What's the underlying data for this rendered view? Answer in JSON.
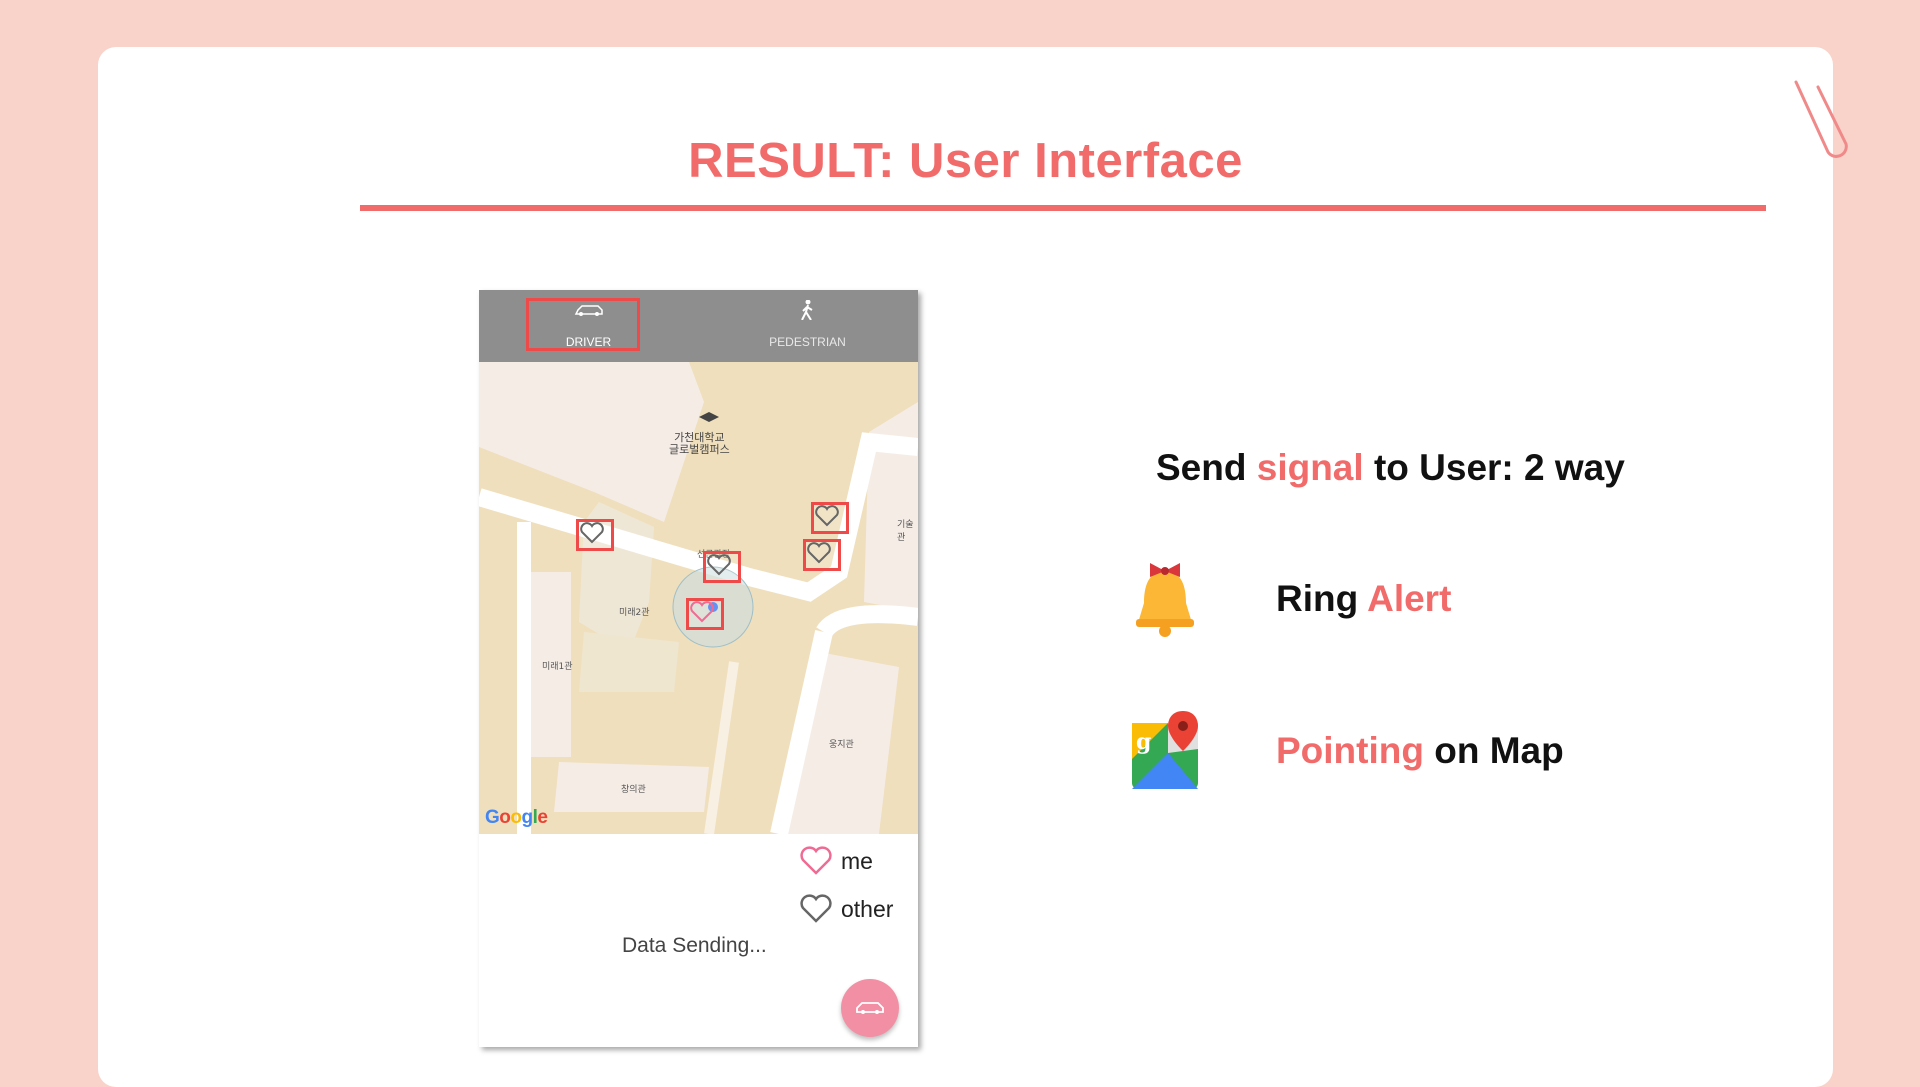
{
  "slide": {
    "title": "RESULT: User Interface"
  },
  "phone": {
    "tabs": [
      {
        "label": "DRIVER",
        "icon": "car-icon",
        "selected": true
      },
      {
        "label": "PEDESTRIAN",
        "icon": "pedestrian-icon",
        "selected": false
      }
    ],
    "map": {
      "provider_logo": "Google",
      "labels": {
        "campus": "가천대학교\n글로벌캠퍼스",
        "mirae2": "미래2관",
        "mirae1": "미래1관",
        "unggi": "웅지관",
        "changui": "창의관",
        "gisul": "기술관",
        "seonbae": "선큰광장"
      }
    },
    "legend": {
      "me": "me",
      "other": "other"
    },
    "status": "Data Sending...",
    "colors": {
      "tabbar": "#8e8e8e",
      "highlight": "#ef4a4a",
      "me_heart": "#f06b93",
      "other_heart": "#666666",
      "fab": "#f28fa4"
    }
  },
  "right": {
    "heading": {
      "part1": "Send ",
      "accent": "signal",
      "part2": " to User: 2 way"
    },
    "features": [
      {
        "icon": "bell-icon",
        "text": "Ring ",
        "accent": "Alert"
      },
      {
        "icon": "google-maps-icon",
        "accent": "Pointing",
        "text": " on Map"
      }
    ]
  }
}
